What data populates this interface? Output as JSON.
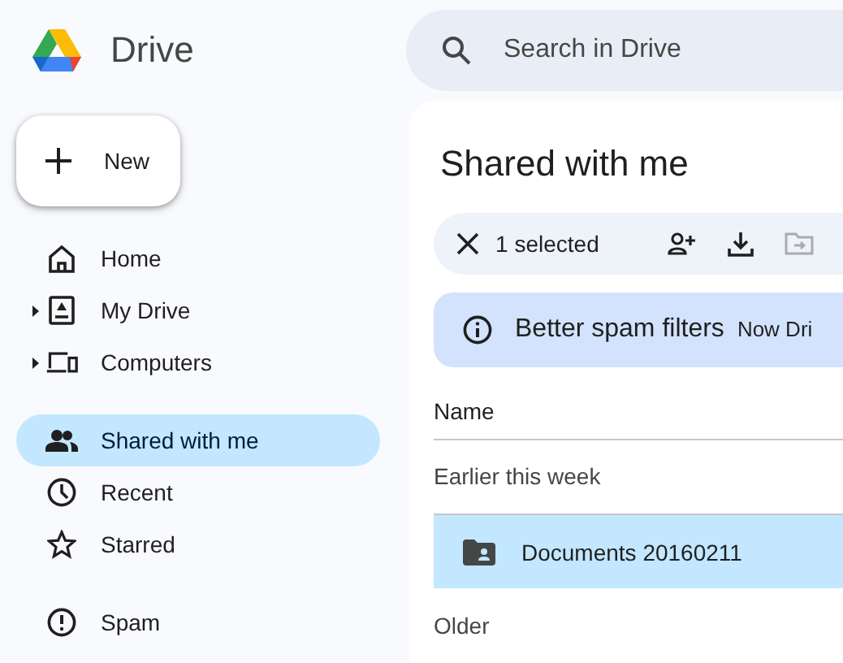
{
  "app": {
    "name": "Drive"
  },
  "search": {
    "placeholder": "Search in Drive"
  },
  "new_button": {
    "label": "New"
  },
  "sidebar": {
    "sections": [
      {
        "items": [
          {
            "label": "Home",
            "expandable": false,
            "selected": false
          },
          {
            "label": "My Drive",
            "expandable": true,
            "selected": false
          },
          {
            "label": "Computers",
            "expandable": true,
            "selected": false
          }
        ]
      },
      {
        "items": [
          {
            "label": "Shared with me",
            "expandable": false,
            "selected": true
          },
          {
            "label": "Recent",
            "expandable": false,
            "selected": false
          },
          {
            "label": "Starred",
            "expandable": false,
            "selected": false
          }
        ]
      },
      {
        "items": [
          {
            "label": "Spam",
            "expandable": false,
            "selected": false
          }
        ]
      }
    ]
  },
  "main": {
    "title": "Shared with me",
    "selection_bar": {
      "count_label": "1 selected",
      "actions": [
        {
          "disabled": false
        },
        {
          "disabled": false
        },
        {
          "disabled": true
        }
      ]
    },
    "banner": {
      "title": "Better spam filters",
      "text": "Now Dri"
    },
    "table": {
      "columns": [
        "Name"
      ],
      "groups": [
        {
          "label": "Earlier this week",
          "rows": [
            {
              "name": "Documents 20160211",
              "selected": true
            }
          ]
        },
        {
          "label": "Older"
        }
      ]
    }
  }
}
